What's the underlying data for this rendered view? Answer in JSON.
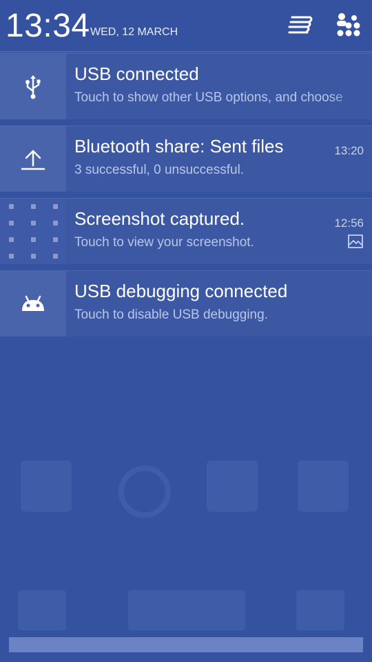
{
  "status": {
    "time": "13:34",
    "date": "WED, 12 MARCH"
  },
  "header": {
    "settings_icon": "quick-settings-icon",
    "accounts_icon": "users-grid-icon"
  },
  "notifications": [
    {
      "title": "USB connected",
      "text": "Touch to show other USB options, and choose",
      "time": "",
      "icon": "usb-icon"
    },
    {
      "title": "Bluetooth share: Sent files",
      "text": "3 successful, 0 unsuccessful.",
      "time": "13:20",
      "icon": "upload-icon"
    },
    {
      "title": "Screenshot captured.",
      "text": "Touch to view your screenshot.",
      "time": "12:56",
      "icon": "screenshot-thumbnail",
      "small_icon": "image-icon"
    },
    {
      "title": "USB debugging connected",
      "text": "Touch to disable USB debugging.",
      "time": "",
      "icon": "android-icon"
    }
  ],
  "colors": {
    "background": "#3452a0",
    "notification_bg": "#3d58a3",
    "icon_tile": "#4a64ac",
    "handle": "#6b82c4"
  }
}
